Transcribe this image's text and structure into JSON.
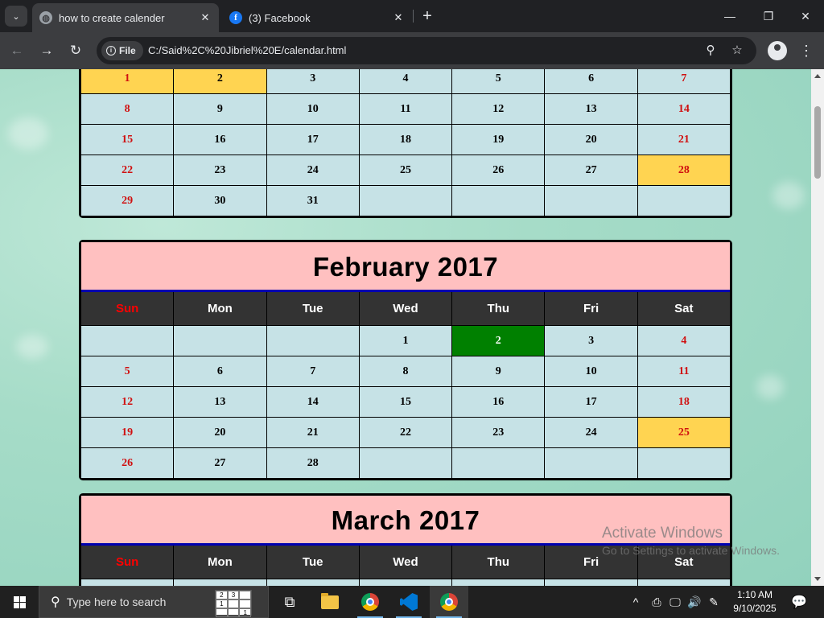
{
  "browser": {
    "tabs": [
      {
        "title": "how to create calender",
        "active": true,
        "favicon": "globe-icon"
      },
      {
        "title": "(3) Facebook",
        "active": false,
        "favicon": "facebook-icon"
      }
    ],
    "close_glyph": "✕",
    "new_tab_glyph": "+",
    "window_controls": {
      "minimize": "—",
      "maximize": "❐",
      "close": "✕"
    },
    "nav": {
      "back": "←",
      "forward": "→",
      "reload": "↻"
    },
    "site_chip_label": "File",
    "url": "C:/Said%2C%20Jibriel%20E/calendar.html",
    "zoom_glyph": "⚲",
    "bookmark_glyph": "☆",
    "menu_glyph": "⋮"
  },
  "weekday_headers": [
    "Sun",
    "Mon",
    "Tue",
    "Wed",
    "Thu",
    "Fri",
    "Sat"
  ],
  "colors": {
    "header_bg": "#ffc0c0",
    "cell_bg": "#c6e2e6",
    "weekend_text": "#d01010",
    "holiday_bg": "#ffd451",
    "today_bg": "#008000",
    "dow_bg": "#333333"
  },
  "months": [
    {
      "id": "january",
      "title": "",
      "show_header": false,
      "show_weekdays": false,
      "weeks": [
        [
          {
            "d": "1",
            "h": true
          },
          {
            "d": "2",
            "h": true
          },
          {
            "d": "3"
          },
          {
            "d": "4"
          },
          {
            "d": "5"
          },
          {
            "d": "6"
          },
          {
            "d": "7"
          }
        ],
        [
          {
            "d": "8"
          },
          {
            "d": "9"
          },
          {
            "d": "10"
          },
          {
            "d": "11"
          },
          {
            "d": "12"
          },
          {
            "d": "13"
          },
          {
            "d": "14"
          }
        ],
        [
          {
            "d": "15"
          },
          {
            "d": "16"
          },
          {
            "d": "17"
          },
          {
            "d": "18"
          },
          {
            "d": "19"
          },
          {
            "d": "20"
          },
          {
            "d": "21"
          }
        ],
        [
          {
            "d": "22"
          },
          {
            "d": "23"
          },
          {
            "d": "24"
          },
          {
            "d": "25"
          },
          {
            "d": "26"
          },
          {
            "d": "27"
          },
          {
            "d": "28",
            "h": true
          }
        ],
        [
          {
            "d": "29"
          },
          {
            "d": "30"
          },
          {
            "d": "31"
          },
          {
            "d": ""
          },
          {
            "d": ""
          },
          {
            "d": ""
          },
          {
            "d": ""
          }
        ]
      ]
    },
    {
      "id": "february",
      "title": "February 2017",
      "show_header": true,
      "show_weekdays": true,
      "weeks": [
        [
          {
            "d": ""
          },
          {
            "d": ""
          },
          {
            "d": ""
          },
          {
            "d": "1"
          },
          {
            "d": "2",
            "t": true
          },
          {
            "d": "3"
          },
          {
            "d": "4"
          }
        ],
        [
          {
            "d": "5"
          },
          {
            "d": "6"
          },
          {
            "d": "7"
          },
          {
            "d": "8"
          },
          {
            "d": "9"
          },
          {
            "d": "10"
          },
          {
            "d": "11"
          }
        ],
        [
          {
            "d": "12"
          },
          {
            "d": "13"
          },
          {
            "d": "14"
          },
          {
            "d": "15"
          },
          {
            "d": "16"
          },
          {
            "d": "17"
          },
          {
            "d": "18"
          }
        ],
        [
          {
            "d": "19"
          },
          {
            "d": "20"
          },
          {
            "d": "21"
          },
          {
            "d": "22"
          },
          {
            "d": "23"
          },
          {
            "d": "24"
          },
          {
            "d": "25",
            "h": true
          }
        ],
        [
          {
            "d": "26"
          },
          {
            "d": "27"
          },
          {
            "d": "28"
          },
          {
            "d": ""
          },
          {
            "d": ""
          },
          {
            "d": ""
          },
          {
            "d": ""
          }
        ]
      ]
    },
    {
      "id": "march",
      "title": "March 2017",
      "show_header": true,
      "show_weekdays": true,
      "weeks": [
        [
          {
            "d": ""
          },
          {
            "d": ""
          },
          {
            "d": ""
          },
          {
            "d": ""
          },
          {
            "d": ""
          },
          {
            "d": ""
          },
          {
            "d": ""
          }
        ]
      ]
    }
  ],
  "watermark": {
    "line1": "Activate Windows",
    "line2": "Go to Settings to activate Windows."
  },
  "taskbar": {
    "search_placeholder": "Type here to search",
    "search_glyph": "⚲",
    "puzzle_digits": [
      "2",
      "3",
      "",
      "1",
      "",
      "",
      "",
      "",
      "1"
    ],
    "task_view_glyph": "⧉",
    "tray_chevron": "^",
    "tray_icons": [
      "⎙",
      "🖵",
      "🔊",
      "✎"
    ],
    "time": "1:10 AM",
    "date": "9/10/2025",
    "notification_glyph": "💬"
  }
}
